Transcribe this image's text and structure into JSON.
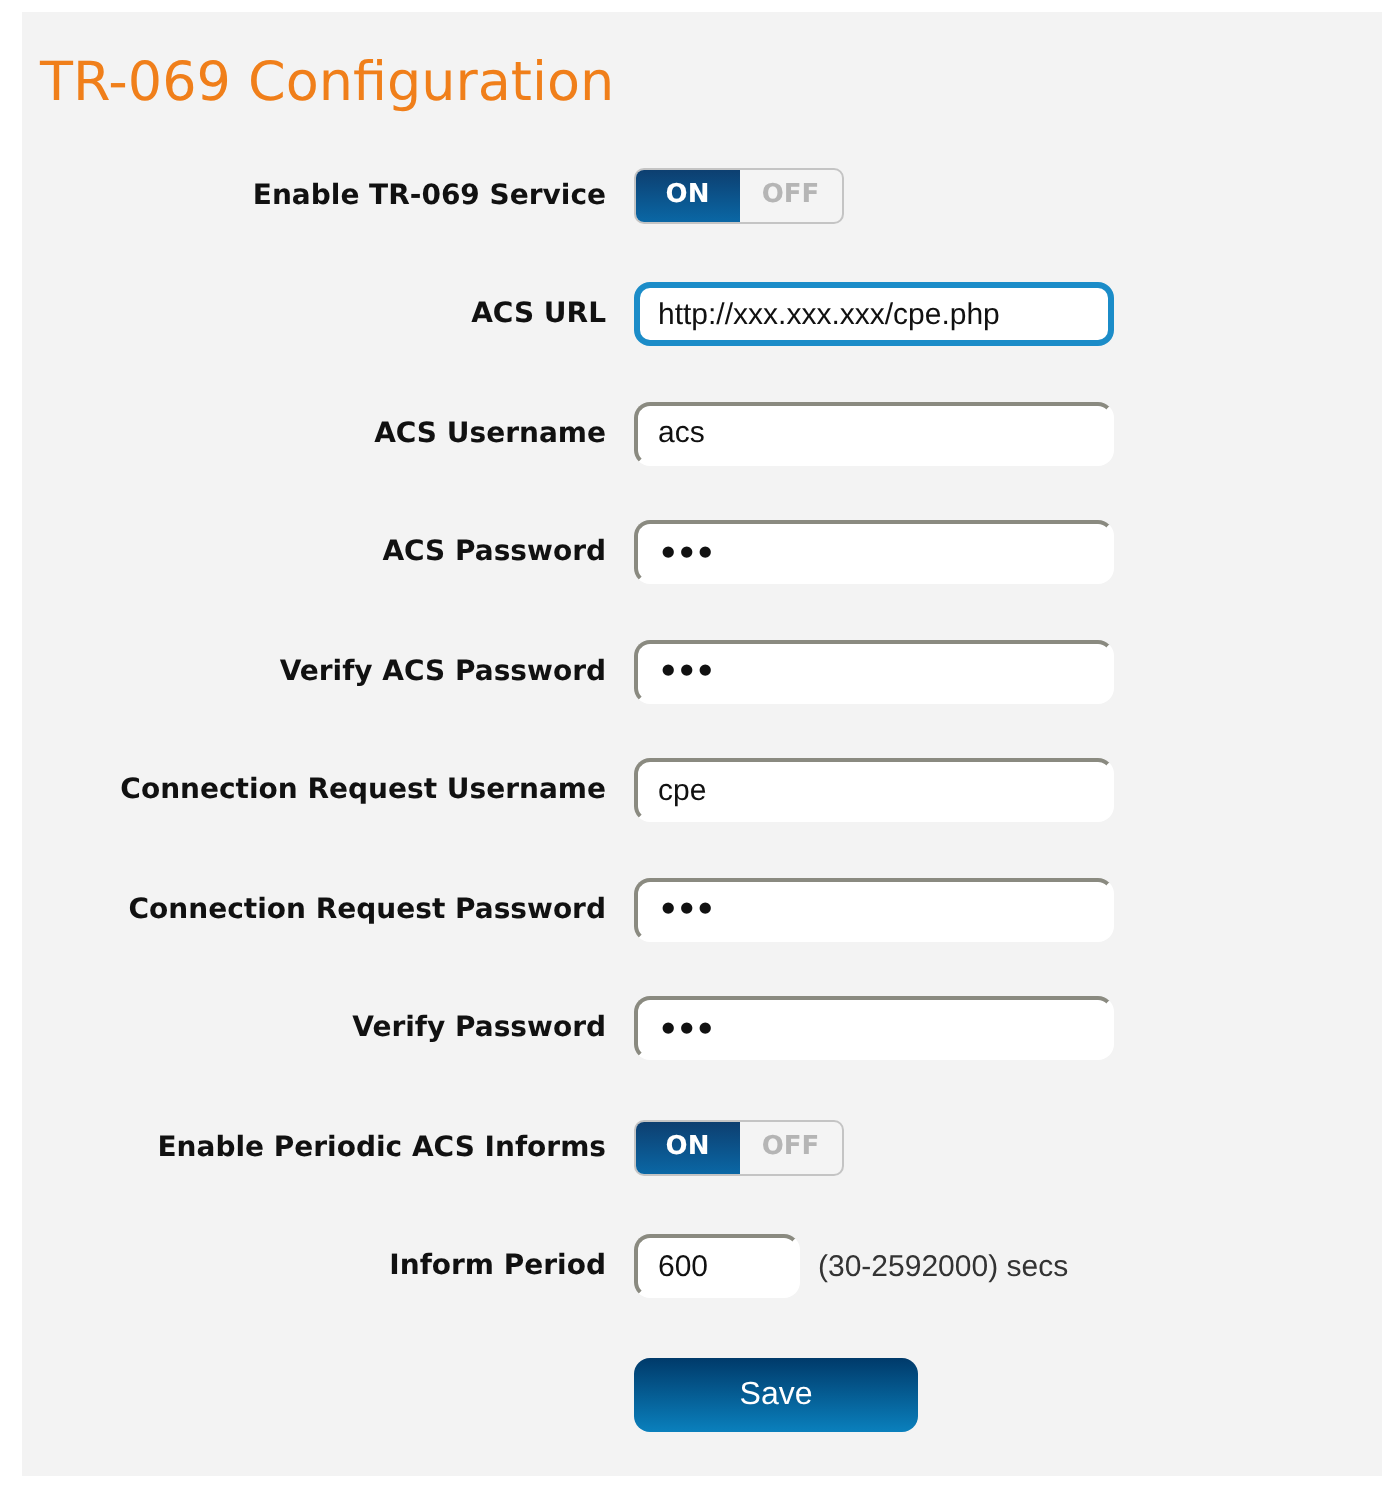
{
  "title": "TR-069 Configuration",
  "rows": [
    {
      "kind": "toggle",
      "label": "Enable TR-069 Service",
      "on": true,
      "on_text": "ON",
      "off_text": "OFF"
    },
    {
      "kind": "text",
      "label": "ACS URL",
      "value": "http://xxx.xxx.xxx/cpe.php",
      "focused": true
    },
    {
      "kind": "text",
      "label": "ACS Username",
      "value": "acs",
      "focused": false
    },
    {
      "kind": "password",
      "label": "ACS Password",
      "value": "•••",
      "focused": false
    },
    {
      "kind": "password",
      "label": "Verify ACS Password",
      "value": "•••",
      "focused": false
    },
    {
      "kind": "text",
      "label": "Connection Request Username",
      "value": "cpe",
      "focused": false
    },
    {
      "kind": "password",
      "label": "Connection Request Password",
      "value": "•••",
      "focused": false
    },
    {
      "kind": "password",
      "label": "Verify Password",
      "value": "•••",
      "focused": false
    },
    {
      "kind": "toggle",
      "label": "Enable Periodic ACS Informs",
      "on": true,
      "on_text": "ON",
      "off_text": "OFF"
    },
    {
      "kind": "short",
      "label": "Inform Period",
      "value": "600",
      "focused": false,
      "hint": "(30-2592000) secs"
    }
  ],
  "save_button": "Save"
}
